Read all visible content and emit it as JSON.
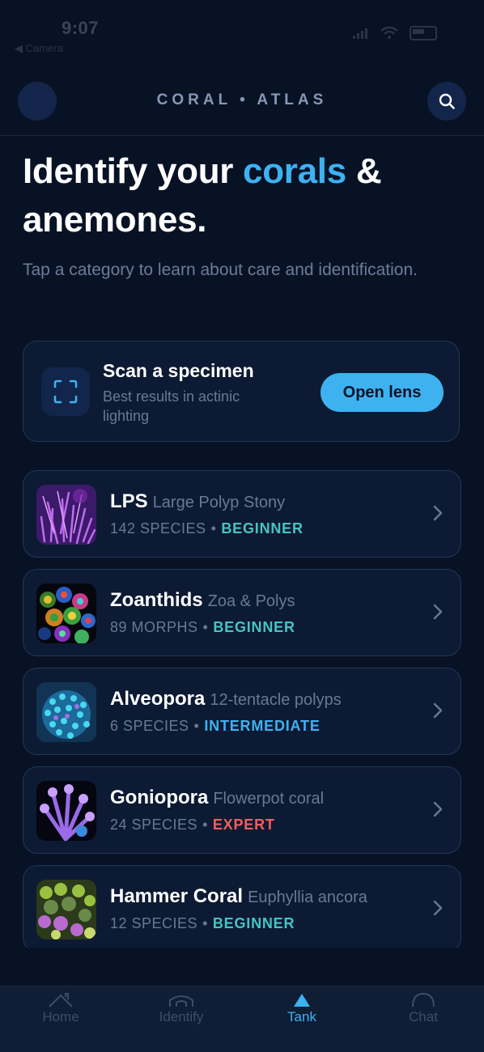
{
  "status_bar": {
    "time": "9:07",
    "back_label": "◀ Camera"
  },
  "header": {
    "brand": "CORAL • ATLAS"
  },
  "hero": {
    "title_part1": "Identify your ",
    "title_accent": "corals",
    "title_part2": " & anemones.",
    "subtitle": "Tap a category to learn about care and identification."
  },
  "scan_card": {
    "title": "Scan a specimen",
    "description": "Best results in actinic lighting",
    "button_label": "Open lens"
  },
  "categories": [
    {
      "name": "LPS",
      "scientific": "Large Polyp Stony",
      "count": "142 SPECIES",
      "level": "BEGINNER",
      "level_color": "#46c4c2",
      "thumb": "lps"
    },
    {
      "name": "Zoanthids",
      "scientific": "Zoa & Polys",
      "count": "89 MORPHS",
      "level": "BEGINNER",
      "level_color": "#46c4c2",
      "thumb": "zoa"
    },
    {
      "name": "Alveopora",
      "scientific": "12-tentacle polyps",
      "count": "6 SPECIES",
      "level": "INTERMEDIATE",
      "level_color": "#3eb2f0",
      "thumb": "alveo"
    },
    {
      "name": "Goniopora",
      "scientific": "Flowerpot coral",
      "count": "24 SPECIES",
      "level": "EXPERT",
      "level_color": "#f0605c",
      "thumb": "gonio"
    },
    {
      "name": "Hammer Coral",
      "scientific": "Euphyllia ancora",
      "count": "12 SPECIES",
      "level": "BEGINNER",
      "level_color": "#46c4c2",
      "thumb": "hammer"
    }
  ],
  "tabs": [
    {
      "label": "Home",
      "icon": "home-icon",
      "active": false
    },
    {
      "label": "Identify",
      "icon": "identify-icon",
      "active": false
    },
    {
      "label": "Tank",
      "icon": "tank-icon",
      "active": true
    },
    {
      "label": "Chat",
      "icon": "chat-icon",
      "active": false
    }
  ],
  "colors": {
    "accent": "#3eb2f0",
    "background": "#081225",
    "card": "#0d1a33"
  }
}
